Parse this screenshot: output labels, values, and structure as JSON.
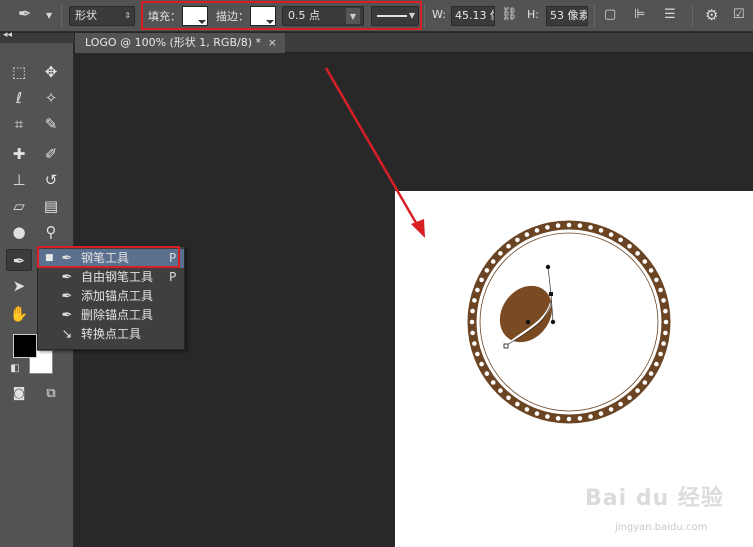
{
  "options_bar": {
    "shape_mode": "形状",
    "fill_label": "填充：",
    "stroke_label": "描边：",
    "stroke_width": "0.5 点",
    "w_label": "W:",
    "w_value": "45.13 像",
    "h_label": "H:",
    "h_value": "53 像素",
    "fill_color": "#ffffff",
    "stroke_color": "#ffffff"
  },
  "tab": {
    "title": "LOGO @ 100% (形状 1, RGB/8) *",
    "close": "×"
  },
  "toolbar": {
    "collapse": "◂◂",
    "tools_left": [
      "marquee-icon",
      "lasso-icon",
      "crop-icon",
      "spot-heal-icon",
      "stamp-icon",
      "eraser-icon",
      "blur-icon",
      "pen-icon",
      "path-select-icon",
      "hand-icon"
    ],
    "tools_right": [
      "move-icon",
      "magic-wand-icon",
      "eyedropper-icon",
      "brush-icon",
      "history-brush-icon",
      "gradient-icon",
      "dodge-icon",
      "text-icon",
      "rectangle-icon",
      "zoom-icon"
    ],
    "fg_color": "#000000",
    "bg_color": "#ffffff"
  },
  "flyout": {
    "items": [
      {
        "label": "钢笔工具",
        "key": "P",
        "selected": true
      },
      {
        "label": "自由钢笔工具",
        "key": "P",
        "selected": false
      },
      {
        "label": "添加锚点工具",
        "key": "",
        "selected": false
      },
      {
        "label": "删除锚点工具",
        "key": "",
        "selected": false
      },
      {
        "label": "转换点工具",
        "key": "",
        "selected": false
      }
    ]
  },
  "watermark": {
    "brand": "Bai du 经验",
    "url": "jingyan.baidu.com"
  },
  "colors": {
    "accent_red": "#d81f26",
    "ring_brown": "#6b4423",
    "bean_brown": "#7a4a22",
    "highlight": "#5b6f8e"
  }
}
